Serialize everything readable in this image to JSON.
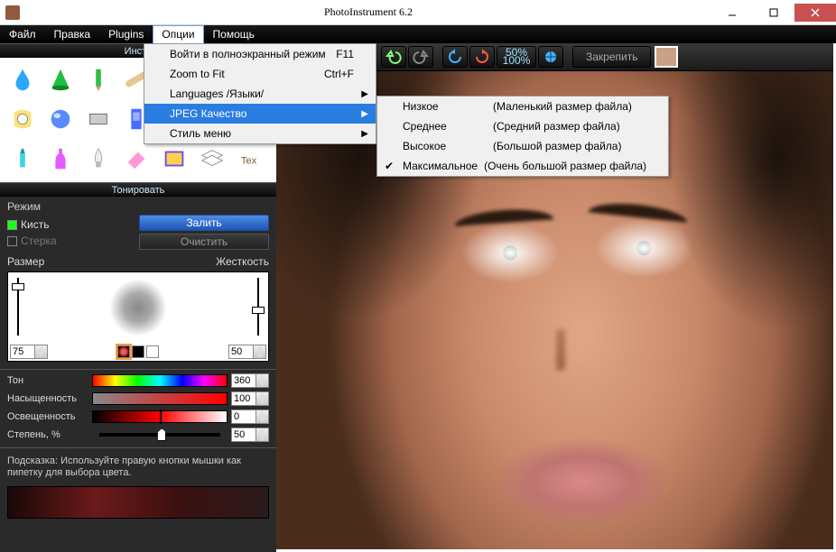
{
  "window": {
    "title": "PhotoInstrument 6.2"
  },
  "menubar": {
    "items": [
      "Файл",
      "Правка",
      "Plugins",
      "Опции",
      "Помощь"
    ],
    "active_index": 3
  },
  "options_menu": {
    "items": [
      {
        "label": "Войти в полноэкранный режим",
        "shortcut": "F11"
      },
      {
        "label": "Zoom to Fit",
        "shortcut": "Ctrl+F"
      },
      {
        "label": "Languages /Языки/",
        "submenu": true
      },
      {
        "label": "JPEG Качество",
        "submenu": true,
        "highlight": true
      },
      {
        "label": "Стиль меню",
        "submenu": true
      }
    ]
  },
  "jpeg_submenu": {
    "items": [
      {
        "label": "Низкое",
        "note": "(Маленький размер файла)"
      },
      {
        "label": "Среднее",
        "note": "(Средний размер файла)"
      },
      {
        "label": "Высокое",
        "note": "(Большой размер файла)"
      },
      {
        "label": "Максимальное",
        "note": "(Очень большой размер файла)",
        "checked": true
      }
    ]
  },
  "tools_panel": {
    "title": "Инстр",
    "selected_index": 11
  },
  "toning_panel": {
    "title": "Тонировать",
    "mode_label": "Режим",
    "brush_label": "Кисть",
    "eraser_label": "Стерка",
    "fill_btn": "Залить",
    "clear_btn": "Очистить",
    "size_label": "Размер",
    "hardness_label": "Жесткость",
    "size_value": "75",
    "hardness_value": "50"
  },
  "params": {
    "hue": {
      "label": "Тон",
      "value": "360"
    },
    "sat": {
      "label": "Насыщенность",
      "value": "100"
    },
    "light": {
      "label": "Освещенность",
      "value": "0"
    },
    "degree": {
      "label": "Степень, %",
      "value": "50"
    }
  },
  "hint": {
    "text": "Подсказка: Используйте правую кнопки мышки как пипетку для выбора цвета."
  },
  "toolbar": {
    "zoom_top": "50%",
    "zoom_bottom": "100%",
    "pin_label": "Закрепить"
  }
}
